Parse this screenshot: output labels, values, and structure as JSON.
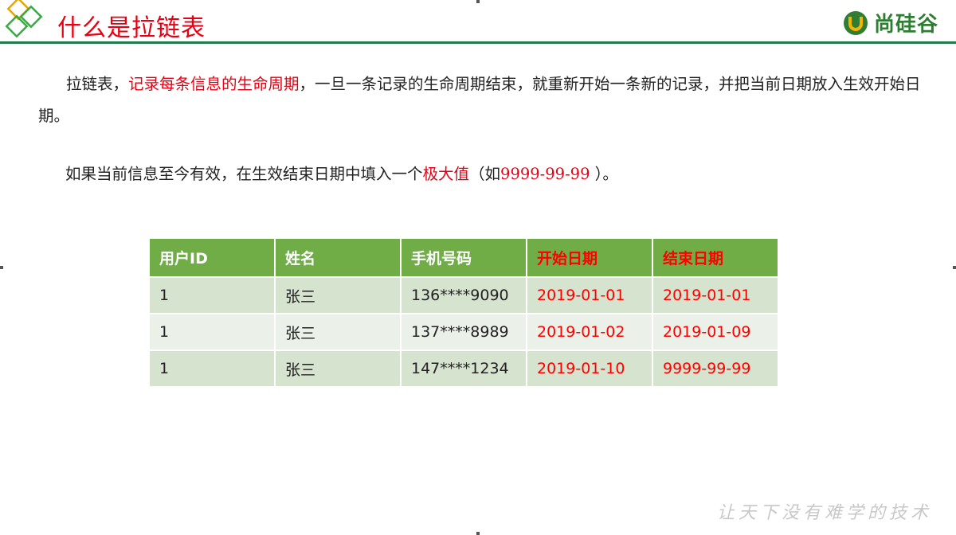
{
  "header": {
    "title": "什么是拉链表",
    "brand_name": "尚硅谷",
    "accent_color": "#1f7a4c",
    "title_color": "#e60012"
  },
  "content": {
    "p1_lead": "拉链表，",
    "p1_highlight": "记录每条信息的生命周期",
    "p1_rest": "，一旦一条记录的生命周期结束，就重新开始一条新的记录，并把当前日期放入生效开始日期。",
    "p2_lead": "如果当前信息至今有效，在生效结束日期中填入一个",
    "p2_highlight": "极大值",
    "p2_paren_open": "（如",
    "p2_value": "9999-99-99",
    "p2_paren_close": " ）。"
  },
  "table": {
    "headers": [
      "用户ID",
      "姓名",
      "手机号码",
      "开始日期",
      "结束日期"
    ],
    "rows": [
      [
        "1",
        "张三",
        "136****9090",
        "2019-01-01",
        "2019-01-01"
      ],
      [
        "1",
        "张三",
        "137****8989",
        "2019-01-02",
        "2019-01-09"
      ],
      [
        "1",
        "张三",
        "147****1234",
        "2019-01-10",
        "9999-99-99"
      ]
    ],
    "header_color": "#70ad47",
    "highlight_color": "#ff0000"
  },
  "footer": {
    "slogan": "让天下没有难学的技术"
  }
}
